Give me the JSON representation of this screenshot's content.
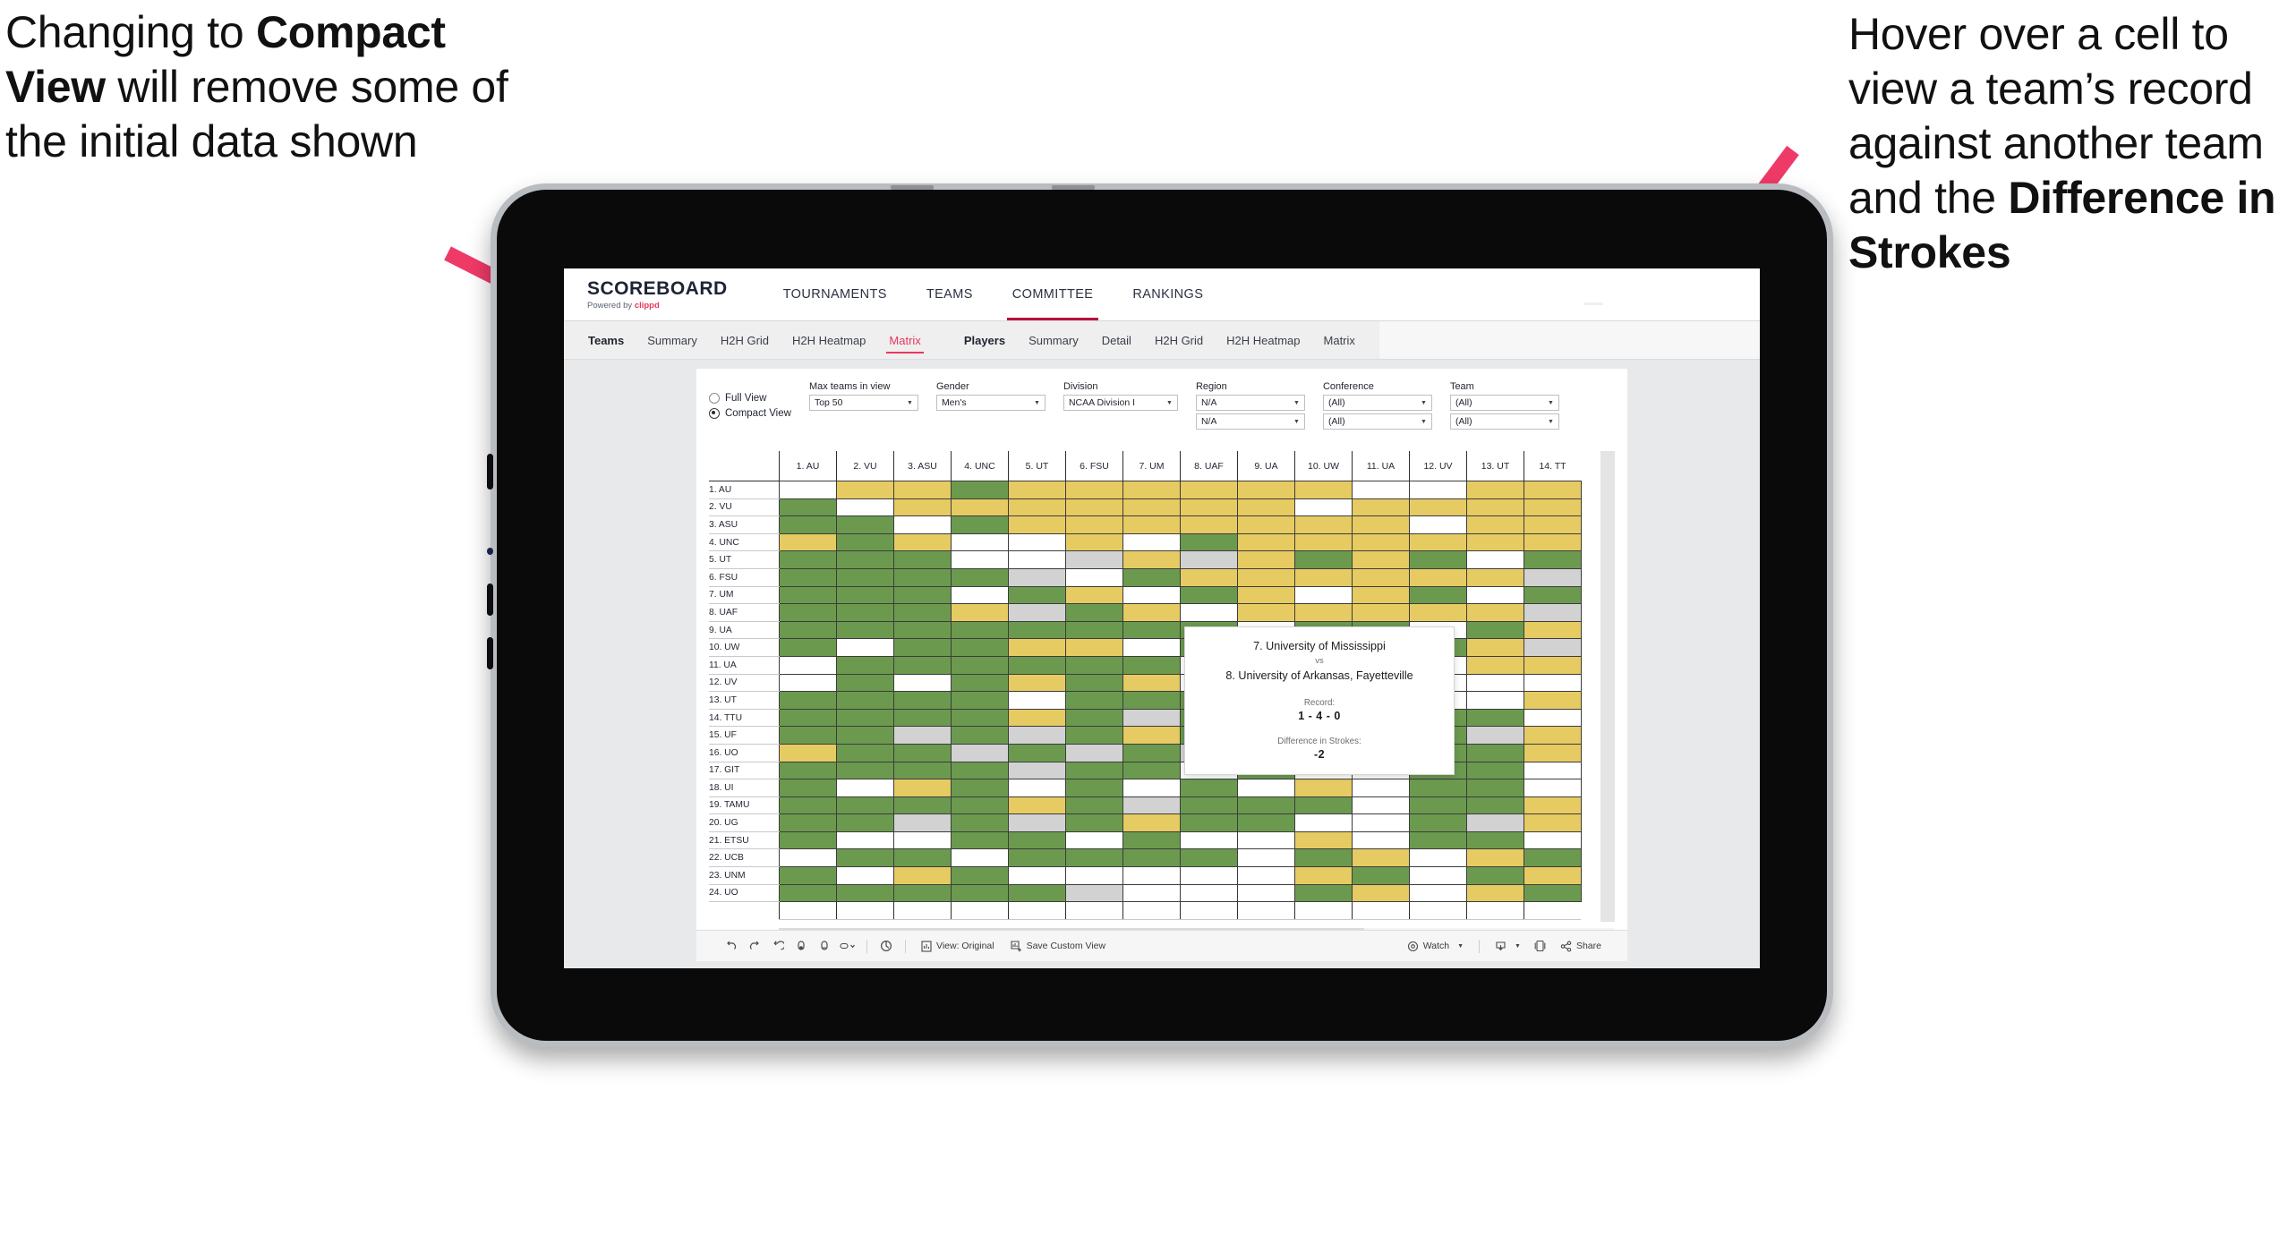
{
  "annotations": {
    "left": {
      "line1": "Changing to",
      "bold": "Compact View",
      "line2": " will remove some of the initial data shown"
    },
    "right": {
      "line1": "Hover over a cell to view a team’s record against another team and the ",
      "bold": "Difference in Strokes"
    }
  },
  "app": {
    "logo": {
      "title": "SCOREBOARD",
      "powered_prefix": "Powered by ",
      "brand": "clippd"
    },
    "topnav": [
      {
        "label": "TOURNAMENTS",
        "active": false
      },
      {
        "label": "TEAMS",
        "active": false
      },
      {
        "label": "COMMITTEE",
        "active": true
      },
      {
        "label": "RANKINGS",
        "active": false
      }
    ],
    "subnav": {
      "group_teams_label": "Teams",
      "teams_items": [
        {
          "label": "Summary",
          "active": false
        },
        {
          "label": "H2H Grid",
          "active": false
        },
        {
          "label": "H2H Heatmap",
          "active": false
        },
        {
          "label": "Matrix",
          "active": true
        }
      ],
      "group_players_label": "Players",
      "players_items": [
        {
          "label": "Summary",
          "active": false
        },
        {
          "label": "Detail",
          "active": false
        },
        {
          "label": "H2H Grid",
          "active": false
        },
        {
          "label": "H2H Heatmap",
          "active": false
        },
        {
          "label": "Matrix",
          "active": false
        }
      ]
    },
    "filters": {
      "view_mode": [
        {
          "label": "Full View",
          "selected": false
        },
        {
          "label": "Compact View",
          "selected": true
        }
      ],
      "controls": [
        {
          "label": "Max teams in view",
          "value": "Top 50"
        },
        {
          "label": "Gender",
          "value": "Men's"
        },
        {
          "label": "Division",
          "value": "NCAA Division I"
        },
        {
          "label": "Region",
          "value": "N/A",
          "value2": "N/A"
        },
        {
          "label": "Conference",
          "value": "(All)",
          "value2": "(All)"
        },
        {
          "label": "Team",
          "value": "(All)",
          "value2": "(All)"
        }
      ]
    },
    "toolbar": {
      "view_original": "View: Original",
      "save_custom_view": "Save Custom View",
      "watch": "Watch",
      "share": "Share",
      "icons": [
        "undo-icon",
        "redo-icon",
        "revert-icon",
        "refresh-data-icon",
        "pause-updates-icon",
        "shape-dropdown-icon",
        "clear-sheet-icon",
        "view-original-icon",
        "save-custom-view-icon",
        "watch-icon",
        "download-icon",
        "device-layout-icon",
        "share-icon"
      ]
    },
    "tooltip": {
      "team_a": "7. University of Mississippi",
      "vs": "vs",
      "team_b": "8. University of Arkansas, Fayetteville",
      "record_label": "Record:",
      "record_value": "1 - 4 - 0",
      "diff_label": "Difference in Strokes:",
      "diff_value": "-2"
    }
  },
  "chart_data": {
    "type": "heatmap",
    "title": "Teams Head-to-Head Matrix",
    "legend_colors": {
      "win": "#6b9a4f",
      "loss": "#e6cb63",
      "none": "#ffffff",
      "tie": "#d2d2d2"
    },
    "columns": [
      "1. AU",
      "2. VU",
      "3. ASU",
      "4. UNC",
      "5. UT",
      "6. FSU",
      "7. UM",
      "8. UAF",
      "9. UA",
      "10. UW",
      "11. UA",
      "12. UV",
      "13. UT",
      "14. TT"
    ],
    "rows": [
      "1. AU",
      "2. VU",
      "3. ASU",
      "4. UNC",
      "5. UT",
      "6. FSU",
      "7. UM",
      "8. UAF",
      "9. UA",
      "10. UW",
      "11. UA",
      "12. UV",
      "13. UT",
      "14. TTU",
      "15. UF",
      "16. UO",
      "17. GIT",
      "18. UI",
      "19. TAMU",
      "20. UG",
      "21. ETSU",
      "22. UCB",
      "23. UNM",
      "24. UO"
    ],
    "cells": [
      [
        "w",
        "y",
        "y",
        "g",
        "y",
        "y",
        "y",
        "y",
        "y",
        "y",
        "w",
        "w",
        "y",
        "y"
      ],
      [
        "g",
        "w",
        "y",
        "y",
        "y",
        "y",
        "y",
        "y",
        "y",
        "w",
        "y",
        "y",
        "y",
        "y"
      ],
      [
        "g",
        "g",
        "w",
        "g",
        "y",
        "y",
        "y",
        "y",
        "y",
        "y",
        "y",
        "w",
        "y",
        "y"
      ],
      [
        "y",
        "g",
        "y",
        "w",
        "w",
        "y",
        "w",
        "g",
        "y",
        "y",
        "y",
        "y",
        "y",
        "y"
      ],
      [
        "g",
        "g",
        "g",
        "w",
        "w",
        "x",
        "y",
        "x",
        "y",
        "g",
        "y",
        "g",
        "w",
        "g"
      ],
      [
        "g",
        "g",
        "g",
        "g",
        "x",
        "w",
        "g",
        "y",
        "y",
        "y",
        "y",
        "y",
        "y",
        "x"
      ],
      [
        "g",
        "g",
        "g",
        "w",
        "g",
        "y",
        "w",
        "g",
        "y",
        "w",
        "y",
        "g",
        "w",
        "g"
      ],
      [
        "g",
        "g",
        "g",
        "y",
        "x",
        "g",
        "y",
        "w",
        "y",
        "y",
        "y",
        "y",
        "y",
        "x"
      ],
      [
        "g",
        "g",
        "g",
        "g",
        "g",
        "g",
        "g",
        "g",
        "w",
        "g",
        "g",
        "w",
        "g",
        "y"
      ],
      [
        "g",
        "w",
        "g",
        "g",
        "y",
        "y",
        "w",
        "g",
        "g",
        "w",
        "g",
        "g",
        "y",
        "x"
      ],
      [
        "w",
        "g",
        "g",
        "g",
        "g",
        "g",
        "g",
        "w",
        "g",
        "w",
        "w",
        "w",
        "y",
        "y"
      ],
      [
        "w",
        "g",
        "w",
        "g",
        "y",
        "g",
        "y",
        "w",
        "g",
        "g",
        "w",
        "w",
        "w",
        "w"
      ],
      [
        "g",
        "g",
        "g",
        "g",
        "w",
        "g",
        "g",
        "g",
        "g",
        "g",
        "g",
        "w",
        "w",
        "y"
      ],
      [
        "g",
        "g",
        "g",
        "g",
        "y",
        "g",
        "x",
        "g",
        "y",
        "g",
        "g",
        "g",
        "g",
        "w"
      ],
      [
        "g",
        "g",
        "x",
        "g",
        "x",
        "g",
        "y",
        "g",
        "g",
        "w",
        "w",
        "g",
        "x",
        "y"
      ],
      [
        "y",
        "g",
        "g",
        "x",
        "g",
        "x",
        "g",
        "x",
        "g",
        "w",
        "g",
        "g",
        "g",
        "y"
      ],
      [
        "g",
        "g",
        "g",
        "g",
        "x",
        "g",
        "g",
        "w",
        "g",
        "w",
        "w",
        "g",
        "g",
        "w"
      ],
      [
        "g",
        "w",
        "y",
        "g",
        "w",
        "g",
        "w",
        "g",
        "w",
        "y",
        "w",
        "g",
        "g",
        "w"
      ],
      [
        "g",
        "g",
        "g",
        "g",
        "y",
        "g",
        "x",
        "g",
        "g",
        "g",
        "w",
        "g",
        "g",
        "y"
      ],
      [
        "g",
        "g",
        "x",
        "g",
        "x",
        "g",
        "y",
        "g",
        "g",
        "w",
        "w",
        "g",
        "x",
        "y"
      ],
      [
        "g",
        "w",
        "w",
        "g",
        "g",
        "w",
        "g",
        "w",
        "w",
        "y",
        "w",
        "g",
        "g",
        "w"
      ],
      [
        "w",
        "g",
        "g",
        "w",
        "g",
        "g",
        "g",
        "g",
        "w",
        "g",
        "y",
        "w",
        "y",
        "g"
      ],
      [
        "g",
        "w",
        "y",
        "g",
        "w",
        "w",
        "w",
        "w",
        "w",
        "y",
        "g",
        "w",
        "g",
        "y"
      ],
      [
        "g",
        "g",
        "g",
        "g",
        "g",
        "x",
        "w",
        "w",
        "w",
        "g",
        "y",
        "w",
        "y",
        "g"
      ]
    ]
  }
}
